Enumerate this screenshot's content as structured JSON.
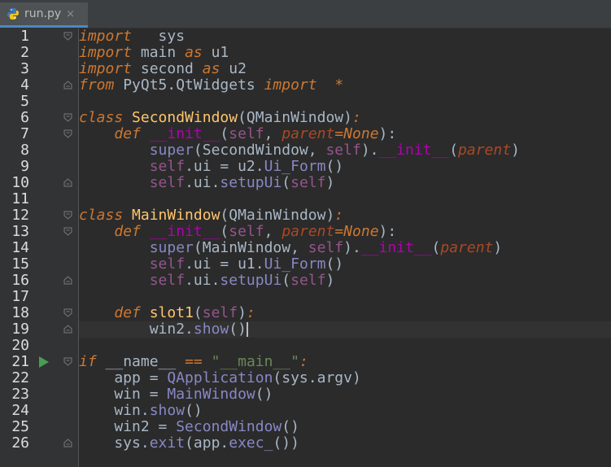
{
  "tab": {
    "title": "run.py",
    "close_glyph": "×",
    "icon": "python-file-icon"
  },
  "current_line": 19,
  "lines": [
    {
      "n": "1",
      "tokens": [
        [
          "kw",
          "import"
        ],
        [
          "",
          "   sys"
        ]
      ]
    },
    {
      "n": "2",
      "tokens": [
        [
          "kw",
          "import"
        ],
        [
          "",
          " main "
        ],
        [
          "kw",
          "as"
        ],
        [
          "",
          " u1"
        ]
      ]
    },
    {
      "n": "3",
      "tokens": [
        [
          "kw",
          "import"
        ],
        [
          "",
          " second "
        ],
        [
          "kw",
          "as"
        ],
        [
          "",
          " u2"
        ]
      ]
    },
    {
      "n": "4",
      "tokens": [
        [
          "kw",
          "from"
        ],
        [
          "",
          " PyQt5.QtWidgets "
        ],
        [
          "kw",
          "import"
        ],
        [
          "",
          "  "
        ],
        [
          "kw",
          "*"
        ]
      ]
    },
    {
      "n": "5",
      "tokens": []
    },
    {
      "n": "6",
      "tokens": [
        [
          "kw",
          "class "
        ],
        [
          "fn",
          "SecondWindow"
        ],
        [
          "",
          "(QMainWindow)"
        ],
        [
          "kw",
          ":"
        ]
      ]
    },
    {
      "n": "7",
      "tokens": [
        [
          "",
          "    "
        ],
        [
          "kw",
          "def "
        ],
        [
          "dunder",
          "__init__"
        ],
        [
          "",
          "("
        ],
        [
          "self",
          "self"
        ],
        [
          "",
          ", "
        ],
        [
          "param",
          "parent"
        ],
        [
          "kw",
          "="
        ],
        [
          "kw",
          "None"
        ],
        [
          "",
          "):"
        ]
      ]
    },
    {
      "n": "8",
      "tokens": [
        [
          "",
          "        "
        ],
        [
          "bi",
          "super"
        ],
        [
          "",
          "(SecondWindow, "
        ],
        [
          "self",
          "self"
        ],
        [
          "",
          ")."
        ],
        [
          "dunder",
          "__init__"
        ],
        [
          "",
          "("
        ],
        [
          "param",
          "parent"
        ],
        [
          "",
          ")"
        ]
      ]
    },
    {
      "n": "9",
      "tokens": [
        [
          "",
          "        "
        ],
        [
          "self",
          "self"
        ],
        [
          "",
          ".ui = u2."
        ],
        [
          "bi",
          "Ui_Form"
        ],
        [
          "",
          "()"
        ]
      ]
    },
    {
      "n": "10",
      "tokens": [
        [
          "",
          "        "
        ],
        [
          "self",
          "self"
        ],
        [
          "",
          ".ui."
        ],
        [
          "bi",
          "setupUi"
        ],
        [
          "",
          "("
        ],
        [
          "self",
          "self"
        ],
        [
          "",
          ")"
        ]
      ]
    },
    {
      "n": "11",
      "tokens": []
    },
    {
      "n": "12",
      "tokens": [
        [
          "kw",
          "class "
        ],
        [
          "fn",
          "MainWindow"
        ],
        [
          "",
          "(QMainWindow)"
        ],
        [
          "kw",
          ":"
        ]
      ]
    },
    {
      "n": "13",
      "tokens": [
        [
          "",
          "    "
        ],
        [
          "kw",
          "def "
        ],
        [
          "dunder",
          "__init__"
        ],
        [
          "",
          "("
        ],
        [
          "self",
          "self"
        ],
        [
          "",
          ", "
        ],
        [
          "param",
          "parent"
        ],
        [
          "kw",
          "="
        ],
        [
          "kw",
          "None"
        ],
        [
          "",
          "):"
        ]
      ]
    },
    {
      "n": "14",
      "tokens": [
        [
          "",
          "        "
        ],
        [
          "bi",
          "super"
        ],
        [
          "",
          "(MainWindow, "
        ],
        [
          "self",
          "self"
        ],
        [
          "",
          ")."
        ],
        [
          "dunder",
          "__init__"
        ],
        [
          "",
          "("
        ],
        [
          "param",
          "parent"
        ],
        [
          "",
          ")"
        ]
      ]
    },
    {
      "n": "15",
      "tokens": [
        [
          "",
          "        "
        ],
        [
          "self",
          "self"
        ],
        [
          "",
          ".ui = u1."
        ],
        [
          "bi",
          "Ui_Form"
        ],
        [
          "",
          "()"
        ]
      ]
    },
    {
      "n": "16",
      "tokens": [
        [
          "",
          "        "
        ],
        [
          "self",
          "self"
        ],
        [
          "",
          ".ui."
        ],
        [
          "bi",
          "setupUi"
        ],
        [
          "",
          "("
        ],
        [
          "self",
          "self"
        ],
        [
          "",
          ")"
        ]
      ]
    },
    {
      "n": "17",
      "tokens": []
    },
    {
      "n": "18",
      "tokens": [
        [
          "",
          "    "
        ],
        [
          "kw",
          "def "
        ],
        [
          "fn",
          "slot1"
        ],
        [
          "",
          "("
        ],
        [
          "self",
          "self"
        ],
        [
          "",
          ")"
        ],
        [
          "kw",
          ":"
        ]
      ]
    },
    {
      "n": "19",
      "tokens": [
        [
          "",
          "        win2."
        ],
        [
          "bi",
          "show"
        ],
        [
          "",
          "()"
        ]
      ]
    },
    {
      "n": "20",
      "tokens": []
    },
    {
      "n": "21",
      "tokens": [
        [
          "kw",
          "if "
        ],
        [
          "",
          "__name__ "
        ],
        [
          "kw",
          "=="
        ],
        [
          "",
          " "
        ],
        [
          "str",
          "\"__main__\""
        ],
        [
          "kw",
          ":"
        ]
      ]
    },
    {
      "n": "22",
      "tokens": [
        [
          "",
          "    app = "
        ],
        [
          "bi",
          "QApplication"
        ],
        [
          "",
          "(sys.argv)"
        ]
      ]
    },
    {
      "n": "23",
      "tokens": [
        [
          "",
          "    win = "
        ],
        [
          "bi",
          "MainWindow"
        ],
        [
          "",
          "()"
        ]
      ]
    },
    {
      "n": "24",
      "tokens": [
        [
          "",
          "    win."
        ],
        [
          "bi",
          "show"
        ],
        [
          "",
          "()"
        ]
      ]
    },
    {
      "n": "25",
      "tokens": [
        [
          "",
          "    win2 = "
        ],
        [
          "bi",
          "SecondWindow"
        ],
        [
          "",
          "()"
        ]
      ]
    },
    {
      "n": "26",
      "tokens": [
        [
          "",
          "    sys."
        ],
        [
          "bi",
          "exit"
        ],
        [
          "",
          "(app."
        ],
        [
          "bi",
          "exec_"
        ],
        [
          "",
          "())"
        ]
      ]
    }
  ],
  "fold_markers_open": [
    1,
    6,
    7,
    12,
    13,
    18,
    21
  ],
  "fold_markers_close": [
    4,
    10,
    16,
    19,
    26
  ],
  "run_gutter_line": 21
}
